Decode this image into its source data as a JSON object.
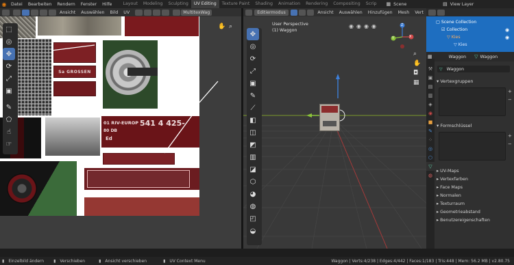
{
  "topbar": {
    "menus": [
      "Datei",
      "Bearbeiten",
      "Rendern",
      "Fenster",
      "Hilfe"
    ],
    "workspaces": [
      "Layout",
      "Modeling",
      "Sculpting",
      "UV Editing",
      "Texture Paint",
      "Shading",
      "Animation",
      "Rendering",
      "Compositing",
      "Scrip"
    ],
    "active_workspace_index": 3,
    "scene_label": "Scene",
    "view_layer_label": "View Layer"
  },
  "uv_editor": {
    "menus": [
      "Ansicht",
      "Auswählen",
      "Bild",
      "UV"
    ],
    "image_name": "MultitexWag"
  },
  "viewport": {
    "mode": "Editiermodus",
    "menus": [
      "Ansicht",
      "Auswählen",
      "Hinzufügen",
      "Mesh",
      "Vert"
    ],
    "perspective_label": "User Perspective",
    "object_label": "(1) Waggon",
    "gizmo_axes": {
      "x": "X",
      "y": "Y",
      "z": "Z"
    }
  },
  "texture_labels": {
    "wagon_number_top": "01 RIV-EUROP",
    "wagon_number_main": "541 4 425-",
    "db_line": "80 DB",
    "ed_line": "Ed",
    "side_text": "Sa GROSSEN"
  },
  "outliner": {
    "items": [
      {
        "label": "Scene Collection"
      },
      {
        "label": "Collection"
      },
      {
        "label": "Kies"
      },
      {
        "label": "Kies"
      }
    ]
  },
  "properties": {
    "object_name_left": "Waggon",
    "object_name_right": "Waggon",
    "mesh_name": "Waggon",
    "panels": {
      "vertex_groups": "Vertexgruppen",
      "shape_keys": "Formschlüssel"
    },
    "collapsed": [
      "UV-Maps",
      "Vertexfarben",
      "Face Maps",
      "Normalen",
      "Texturraum",
      "Geometrieabstand",
      "Benutzereigenschaften"
    ]
  },
  "statusbar": {
    "items": [
      "Einzelbild ändern",
      "Verschieben",
      "Ansicht verschieben",
      "UV Context Menu"
    ],
    "stats": "Waggon | Verts:4/238 | Edges:4/442 | Faces:1/183 | Tris:448 | Mem: 56.2 MB | v2.80.75"
  },
  "colors": {
    "accent_blue": "#4772b3",
    "outliner_bg": "#1e6ec0",
    "blender_orange": "#e87d0d"
  }
}
